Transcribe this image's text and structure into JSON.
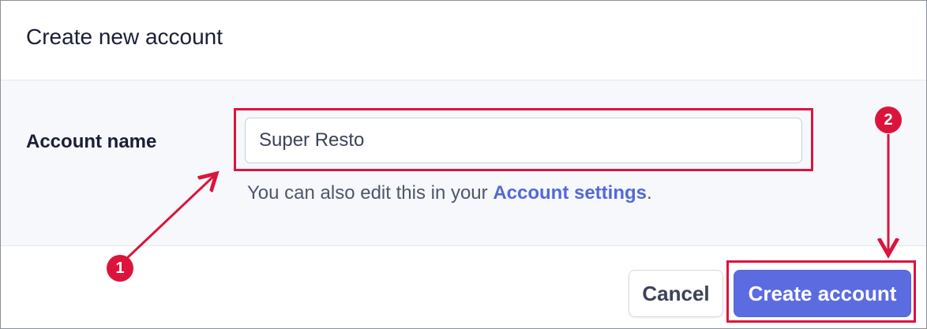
{
  "dialog": {
    "title": "Create new account",
    "field_label": "Account name",
    "input_value": "Super Resto",
    "help_prefix": "You can also edit this in your ",
    "help_link": "Account settings",
    "help_suffix": ".",
    "cancel_label": "Cancel",
    "create_label": "Create account"
  },
  "annotations": {
    "step1": "1",
    "step2": "2"
  },
  "colors": {
    "accent": "#5469d4",
    "annotation": "#dc143c",
    "body_bg": "#f6f8fb"
  }
}
